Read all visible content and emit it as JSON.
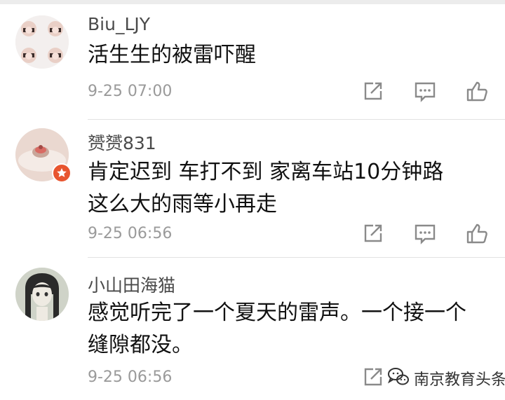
{
  "comments": [
    {
      "username": "Biu_LJY",
      "content": "活生生的被雷吓醒",
      "time": "9-25 07:00",
      "avatar": "photo-grid-avatar"
    },
    {
      "username": "赟赟831",
      "content": "肯定迟到 车打不到 家离车站10分钟路 这么大的雨等小再走",
      "time": "9-25 06:56",
      "avatar": "verified-photo-avatar",
      "badge_color": "#e8552f"
    },
    {
      "username": "小山田海猫",
      "content": "感觉听完了一个夏天的雷声。一个接一个缝隙都没。",
      "time": "9-25 06:56",
      "avatar": "anime-girl-avatar"
    }
  ],
  "actions": {
    "share_icon": "share-icon",
    "reply_icon": "comment-icon",
    "like_icon": "thumbs-up-icon",
    "icon_color": "#8a8a8a"
  },
  "watermark": {
    "text": "南京教育头条",
    "icon": "wechat-icon"
  }
}
